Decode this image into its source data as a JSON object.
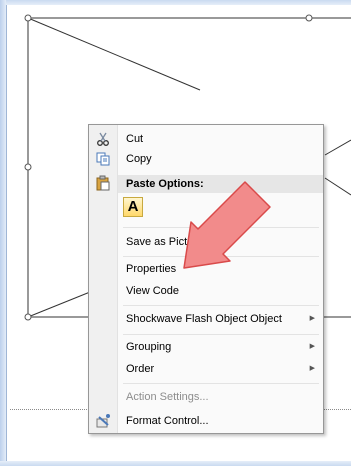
{
  "context_menu": {
    "cut": {
      "label": "Cut",
      "icon": "scissors-icon"
    },
    "copy": {
      "label": "Copy",
      "icon": "copy-icon"
    },
    "paste_options": {
      "label": "Paste Options:",
      "icon": "clipboard-icon",
      "paste_button": "A"
    },
    "save_as_picture": {
      "label": "Save as Pictur"
    },
    "properties": {
      "label": "Properties"
    },
    "view_code": {
      "label": "View Code"
    },
    "shockwave": {
      "label": "Shockwave Flash Object Object",
      "submenu": true
    },
    "grouping": {
      "label": "Grouping",
      "submenu": true
    },
    "order": {
      "label": "Order",
      "submenu": true
    },
    "action_settings": {
      "label": "Action Settings...",
      "disabled": true
    },
    "format_control": {
      "label": "Format Control...",
      "icon": "format-control-icon"
    }
  },
  "annotation": {
    "color": "#f06a6a",
    "points_to": "Properties"
  }
}
